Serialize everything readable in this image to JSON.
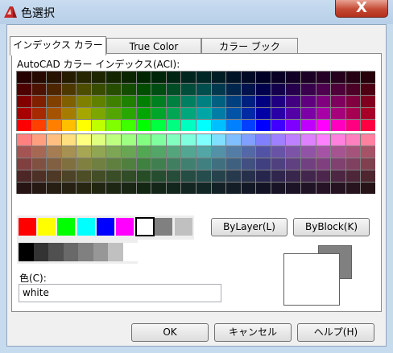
{
  "window": {
    "title": "色選択",
    "close_glyph": "X"
  },
  "tabs": [
    {
      "label": "インデックス カラー"
    },
    {
      "label": "True Color"
    },
    {
      "label": "カラー ブック"
    }
  ],
  "aci_label": "AutoCAD カラー インデックス(ACI):",
  "standard_colors": [
    "#ff0000",
    "#ffff00",
    "#00ff00",
    "#00ffff",
    "#0000ff",
    "#ff00ff",
    "#ffffff",
    "#808080",
    "#c0c0c0"
  ],
  "gray_colors": [
    "#000000",
    "#333333",
    "#505050",
    "#696969",
    "#808080",
    "#979797",
    "#c0c0c0",
    "#ffffff"
  ],
  "buttons": {
    "bylayer": "ByLayer(L)",
    "byblock": "ByBlock(K)",
    "ok": "OK",
    "cancel": "キャンセル",
    "help": "ヘルプ(H)"
  },
  "color_field": {
    "label": "色(C):",
    "value": "white"
  },
  "preview": {
    "new_color": "#ffffff",
    "old_color": "#808080"
  }
}
